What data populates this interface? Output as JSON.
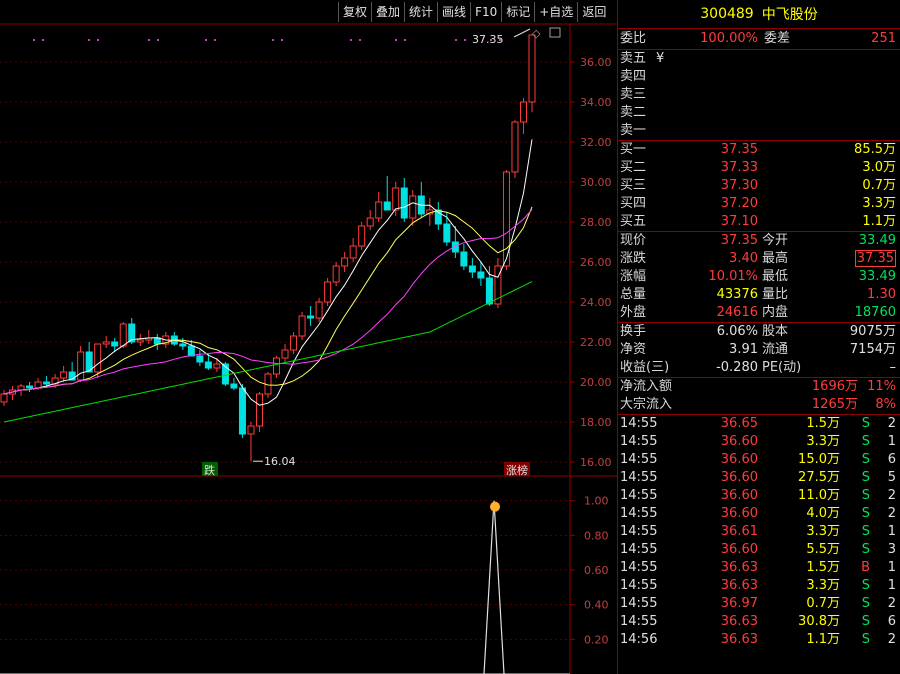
{
  "toolbar": [
    "复权",
    "叠加",
    "统计",
    "画线",
    "F10",
    "标记",
    "+自选",
    "返回"
  ],
  "stock": {
    "code": "300489",
    "name": "中飞股份"
  },
  "weibi": {
    "label": "委比",
    "value": "100.00%",
    "diff_label": "委差",
    "diff": "251"
  },
  "sell": [
    "卖五",
    "卖四",
    "卖三",
    "卖二",
    "卖一"
  ],
  "sell_extra": "¥",
  "buy": [
    {
      "label": "买一",
      "price": "37.35",
      "vol": "85.5万"
    },
    {
      "label": "买二",
      "price": "37.33",
      "vol": "3.0万"
    },
    {
      "label": "买三",
      "price": "37.30",
      "vol": "0.7万"
    },
    {
      "label": "买四",
      "price": "37.20",
      "vol": "3.3万"
    },
    {
      "label": "买五",
      "price": "37.10",
      "vol": "1.1万"
    }
  ],
  "quote": [
    {
      "l1": "现价",
      "v1": "37.35",
      "c1": "red",
      "l2": "今开",
      "v2": "33.49",
      "c2": "grn"
    },
    {
      "l1": "涨跌",
      "v1": "3.40",
      "c1": "red",
      "l2": "最高",
      "v2": "37.35",
      "c2": "red"
    },
    {
      "l1": "涨幅",
      "v1": "10.01%",
      "c1": "red",
      "l2": "最低",
      "v2": "33.49",
      "c2": "grn"
    },
    {
      "l1": "总量",
      "v1": "43376",
      "c1": "yel",
      "l2": "量比",
      "v2": "1.30",
      "c2": "red"
    },
    {
      "l1": "外盘",
      "v1": "24616",
      "c1": "red",
      "l2": "内盘",
      "v2": "18760",
      "c2": "grn"
    }
  ],
  "fund": [
    {
      "l1": "换手",
      "v1": "6.06%",
      "l2": "股本",
      "v2": "9075万"
    },
    {
      "l1": "净资",
      "v1": "3.91",
      "l2": "流通",
      "v2": "7154万"
    },
    {
      "l1": "收益(三)",
      "v1": "-0.280",
      "l2": "PE(动)",
      "v2": "–"
    }
  ],
  "flow": [
    {
      "label": "净流入额",
      "value": "1696万",
      "pct": "11%"
    },
    {
      "label": "大宗流入",
      "value": "1265万",
      "pct": "8%"
    }
  ],
  "ticks": [
    [
      "14:55",
      "36.65",
      "1.5万",
      "S",
      "2"
    ],
    [
      "14:55",
      "36.60",
      "3.3万",
      "S",
      "1"
    ],
    [
      "14:55",
      "36.60",
      "15.0万",
      "S",
      "6"
    ],
    [
      "14:55",
      "36.60",
      "27.5万",
      "S",
      "5"
    ],
    [
      "14:55",
      "36.60",
      "11.0万",
      "S",
      "2"
    ],
    [
      "14:55",
      "36.60",
      "4.0万",
      "S",
      "2"
    ],
    [
      "14:55",
      "36.61",
      "3.3万",
      "S",
      "1"
    ],
    [
      "14:55",
      "36.60",
      "5.5万",
      "S",
      "3"
    ],
    [
      "14:55",
      "36.63",
      "1.5万",
      "B",
      "1"
    ],
    [
      "14:55",
      "36.63",
      "3.3万",
      "S",
      "1"
    ],
    [
      "14:55",
      "36.97",
      "0.7万",
      "S",
      "2"
    ],
    [
      "14:55",
      "36.63",
      "30.8万",
      "S",
      "6"
    ],
    [
      "14:56",
      "36.63",
      "1.1万",
      "S",
      "2"
    ]
  ],
  "chart_data": {
    "type": "candlestick",
    "y_ticks": [
      "36.00",
      "34.00",
      "32.00",
      "30.00",
      "28.00",
      "26.00",
      "24.00",
      "22.00",
      "20.00",
      "18.00",
      "16.00"
    ],
    "ylim": [
      15.5,
      37.8
    ],
    "high_label": "37.35",
    "low_label": "16.04",
    "tags": [
      "跌",
      "涨榜"
    ],
    "candles": [
      [
        19.0,
        19.6,
        18.8,
        19.4
      ],
      [
        19.4,
        19.8,
        19.1,
        19.6
      ],
      [
        19.6,
        19.9,
        19.3,
        19.8
      ],
      [
        19.8,
        20.0,
        19.5,
        19.7
      ],
      [
        19.7,
        20.2,
        19.6,
        20.0
      ],
      [
        20.0,
        20.3,
        19.8,
        19.9
      ],
      [
        19.9,
        20.4,
        19.7,
        20.2
      ],
      [
        20.2,
        20.8,
        20.0,
        20.5
      ],
      [
        20.5,
        21.0,
        20.2,
        20.1
      ],
      [
        20.1,
        21.8,
        20.0,
        21.5
      ],
      [
        21.5,
        22.0,
        21.0,
        20.5
      ],
      [
        20.5,
        21.0,
        20.2,
        21.9
      ],
      [
        21.9,
        22.3,
        21.7,
        22.0
      ],
      [
        22.0,
        22.2,
        21.5,
        21.8
      ],
      [
        21.8,
        23.0,
        21.7,
        22.9
      ],
      [
        22.9,
        23.2,
        21.9,
        22.0
      ],
      [
        22.0,
        22.4,
        21.8,
        22.1
      ],
      [
        22.1,
        22.6,
        21.9,
        22.2
      ],
      [
        22.2,
        22.4,
        21.6,
        21.9
      ],
      [
        21.9,
        22.5,
        21.7,
        22.3
      ],
      [
        22.3,
        22.5,
        21.8,
        21.9
      ],
      [
        21.9,
        22.2,
        21.6,
        21.8
      ],
      [
        21.8,
        22.1,
        21.3,
        21.3
      ],
      [
        21.3,
        21.6,
        20.8,
        21.0
      ],
      [
        21.0,
        21.4,
        20.6,
        20.7
      ],
      [
        20.7,
        21.2,
        20.5,
        20.9
      ],
      [
        20.9,
        21.0,
        19.8,
        19.9
      ],
      [
        19.9,
        20.2,
        19.6,
        19.7
      ],
      [
        19.7,
        19.9,
        17.2,
        17.4
      ],
      [
        17.4,
        18.0,
        16.04,
        17.8
      ],
      [
        17.8,
        19.5,
        17.5,
        19.4
      ],
      [
        19.4,
        20.5,
        19.2,
        20.4
      ],
      [
        20.4,
        21.3,
        20.2,
        21.2
      ],
      [
        21.2,
        21.9,
        21.0,
        21.6
      ],
      [
        21.6,
        22.5,
        21.4,
        22.3
      ],
      [
        22.3,
        23.5,
        22.1,
        23.3
      ],
      [
        23.3,
        23.8,
        22.8,
        23.2
      ],
      [
        23.2,
        24.2,
        23.0,
        24.0
      ],
      [
        24.0,
        25.2,
        23.8,
        25.0
      ],
      [
        25.0,
        26.0,
        24.8,
        25.8
      ],
      [
        25.8,
        26.5,
        25.5,
        26.2
      ],
      [
        26.2,
        27.2,
        26.0,
        26.8
      ],
      [
        26.8,
        28.0,
        26.6,
        27.8
      ],
      [
        27.8,
        28.6,
        27.6,
        28.2
      ],
      [
        28.2,
        29.5,
        28.0,
        29.0
      ],
      [
        29.0,
        30.3,
        28.6,
        28.6
      ],
      [
        28.6,
        30.0,
        28.3,
        29.7
      ],
      [
        29.7,
        30.2,
        28.0,
        28.2
      ],
      [
        28.2,
        29.6,
        27.8,
        29.3
      ],
      [
        29.3,
        30.0,
        28.2,
        28.4
      ],
      [
        28.4,
        29.2,
        27.8,
        28.6
      ],
      [
        28.6,
        29.0,
        27.6,
        27.9
      ],
      [
        27.9,
        28.5,
        26.8,
        27.0
      ],
      [
        27.0,
        27.8,
        26.2,
        26.5
      ],
      [
        26.5,
        26.9,
        25.6,
        25.8
      ],
      [
        25.8,
        26.2,
        25.2,
        25.5
      ],
      [
        25.5,
        26.0,
        24.8,
        25.2
      ],
      [
        25.2,
        25.8,
        23.8,
        23.9
      ],
      [
        23.9,
        26.2,
        23.7,
        25.8
      ],
      [
        25.8,
        30.6,
        25.6,
        30.5
      ],
      [
        30.5,
        33.1,
        30.2,
        33.0
      ],
      [
        33.0,
        34.2,
        32.4,
        34.0
      ],
      [
        34.0,
        37.35,
        33.49,
        37.35
      ]
    ],
    "indicator": {
      "ylim": [
        0,
        1.05
      ],
      "y_ticks": [
        "1.00",
        "0.80",
        "0.60",
        "0.40",
        "0.20"
      ],
      "peak_value": 1.0
    }
  }
}
